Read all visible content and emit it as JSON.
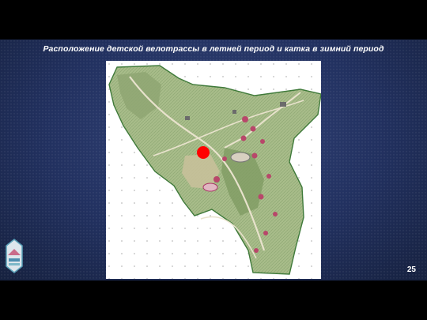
{
  "slide": {
    "title": "Расположение детской велотрассы в летней период и катка в зимний период",
    "page_number": "25"
  },
  "map": {
    "marker_color": "#ff0000",
    "park_fill": "#a9bd8c",
    "boundary_color": "#3f7a3a"
  },
  "colors": {
    "background": "#223160",
    "title": "#ffffff"
  }
}
